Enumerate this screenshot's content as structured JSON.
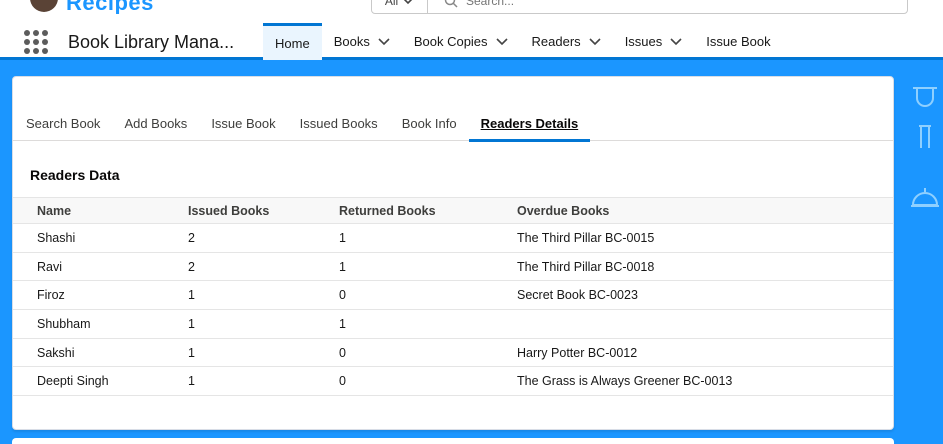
{
  "brand": {
    "logo_text": "Recipes"
  },
  "search": {
    "scope": "All",
    "placeholder": "Search..."
  },
  "app": {
    "name": "Book Library Mana..."
  },
  "nav": {
    "items": [
      {
        "label": "Home",
        "has_menu": false,
        "active": true
      },
      {
        "label": "Books",
        "has_menu": true,
        "active": false
      },
      {
        "label": "Book Copies",
        "has_menu": true,
        "active": false
      },
      {
        "label": "Readers",
        "has_menu": true,
        "active": false
      },
      {
        "label": "Issues",
        "has_menu": true,
        "active": false
      },
      {
        "label": "Issue Book",
        "has_menu": false,
        "active": false
      }
    ]
  },
  "tabs": [
    {
      "label": "Search Book",
      "active": false
    },
    {
      "label": "Add Books",
      "active": false
    },
    {
      "label": "Issue Book",
      "active": false
    },
    {
      "label": "Issued Books",
      "active": false
    },
    {
      "label": "Book Info",
      "active": false
    },
    {
      "label": "Readers Details",
      "active": true
    }
  ],
  "readers": {
    "title": "Readers Data",
    "columns": [
      "Name",
      "Issued Books",
      "Returned Books",
      "Overdue Books"
    ],
    "rows": [
      [
        "Shashi",
        "2",
        "1",
        "The Third Pillar BC-0015"
      ],
      [
        "Ravi",
        "2",
        "1",
        "The Third Pillar BC-0018"
      ],
      [
        "Firoz",
        "1",
        "0",
        "Secret Book BC-0023"
      ],
      [
        "Shubham",
        "1",
        "1",
        ""
      ],
      [
        "Sakshi",
        "1",
        "0",
        "Harry Potter BC-0012"
      ],
      [
        "Deepti Singh",
        "1",
        "0",
        "The Grass is Always Greener BC-0013"
      ]
    ]
  },
  "colors": {
    "brand": "#1b96ff",
    "accent": "#0176d3",
    "active_nav_bg": "#eaf5fe"
  }
}
